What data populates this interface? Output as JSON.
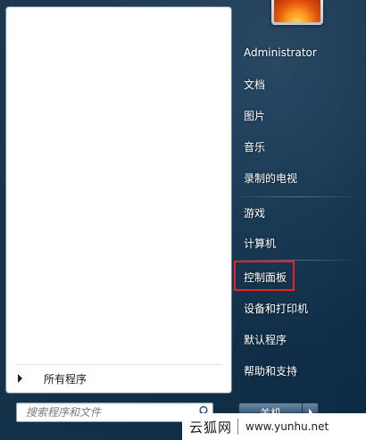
{
  "left_pane": {
    "all_programs_label": "所有程序"
  },
  "search": {
    "placeholder": "搜索程序和文件"
  },
  "user": {
    "name": "Administrator"
  },
  "right_menu": {
    "documents": "文档",
    "pictures": "图片",
    "music": "音乐",
    "recorded_tv": "录制的电视",
    "games": "游戏",
    "computer": "计算机",
    "control_panel": "控制面板",
    "devices_printers": "设备和打印机",
    "default_programs": "默认程序",
    "help_support": "帮助和支持"
  },
  "shutdown": {
    "label": "关机"
  },
  "watermark": {
    "site_name": "云狐网",
    "url": "www.yunhu.net"
  },
  "colors": {
    "highlight_border": "#e8212a",
    "menu_background": "#13314b"
  },
  "icons": {
    "all_programs": "triangle-right-icon",
    "search": "search-icon",
    "shutdown_options": "chevron-right-icon"
  }
}
